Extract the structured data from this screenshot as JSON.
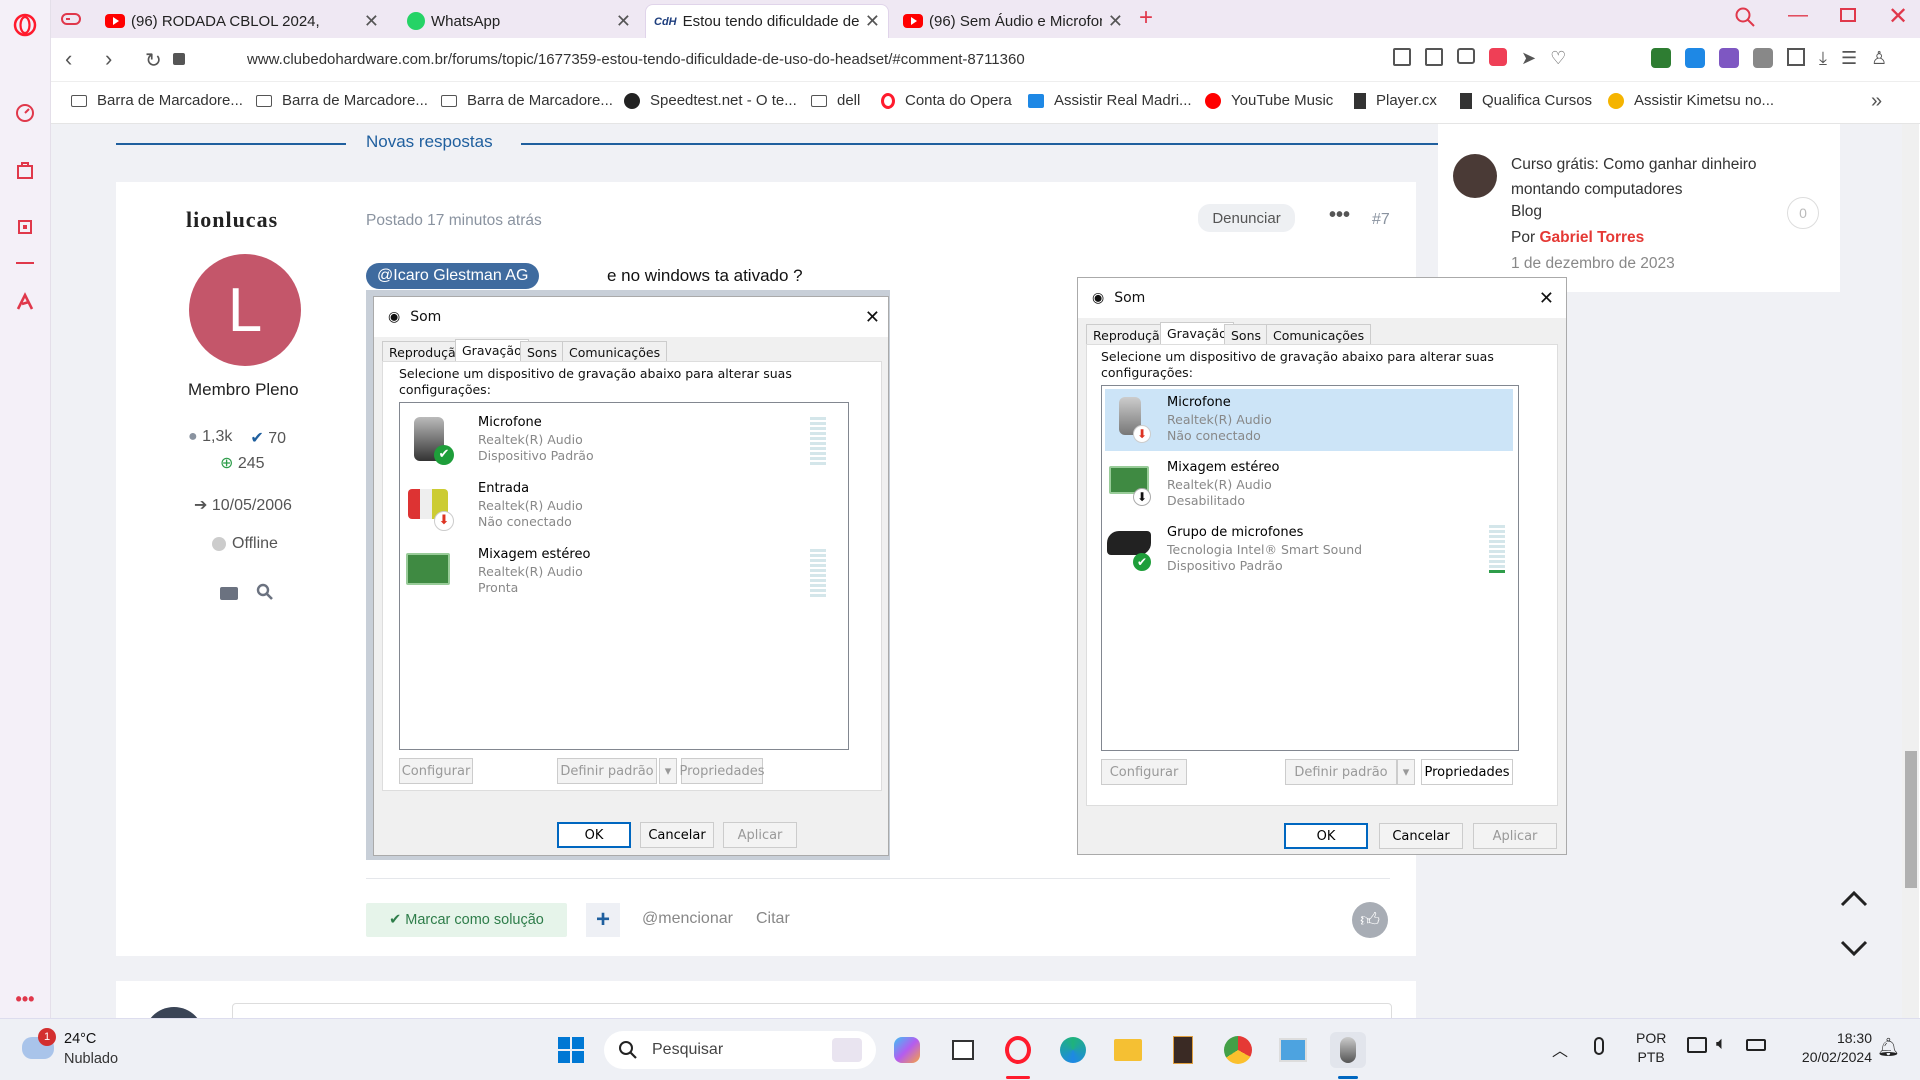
{
  "tabs": [
    {
      "title": "(96) RODADA CBLOL 2024,",
      "icon": "youtube-icon"
    },
    {
      "title": "WhatsApp",
      "icon": "whatsapp-icon"
    },
    {
      "title": "Estou tendo dificuldade de",
      "icon": "site-icon"
    },
    {
      "title": "(96) Sem Áudio e Microfon",
      "icon": "youtube-icon"
    }
  ],
  "address": {
    "url": "www.clubedohardware.com.br/forums/topic/1677359-estou-tendo-dificuldade-de-uso-do-headset/#comment-8711360"
  },
  "bookmarks": [
    "Barra de Marcadore...",
    "Barra de Marcadore...",
    "Barra de Marcadore...",
    "Speedtest.net - O te...",
    "dell",
    "Conta do Opera",
    "Assistir Real Madri...",
    "YouTube Music",
    "Player.cx",
    "Qualifica Cursos",
    "Assistir Kimetsu no..."
  ],
  "section": {
    "title": "Novas respostas"
  },
  "sidebar_post": {
    "title": "Curso grátis: Como ganhar dinheiro montando computadores",
    "category": "Blog",
    "by_prefix": "Por",
    "author": "Gabriel Torres",
    "date": "1 de dezembro de 2023",
    "comments": "0"
  },
  "post": {
    "author": "lionlucas",
    "avatar_letter": "L",
    "rank": "Membro Pleno",
    "posts": "1,3k",
    "solutions": "70",
    "reputation": "245",
    "joined": "10/05/2006",
    "status": "Offline",
    "posted": "Postado 17 minutos atrás",
    "report": "Denunciar",
    "number": "#7",
    "mention": "@Icaro Glestman AG",
    "text": "e no windows ta ativado ?",
    "mark_solution": "Marcar como solução",
    "plus": "+",
    "mention_btn": "@mencionar",
    "quote": "Citar"
  },
  "dialog1": {
    "title": "Som",
    "tabs": [
      "Reprodução",
      "Gravação",
      "Sons",
      "Comunicações"
    ],
    "instruction": "Selecione um dispositivo de gravação abaixo para alterar suas configurações:",
    "devices": [
      {
        "name": "Microfone",
        "driver": "Realtek(R) Audio",
        "state": "Dispositivo Padrão"
      },
      {
        "name": "Entrada",
        "driver": "Realtek(R) Audio",
        "state": "Não conectado"
      },
      {
        "name": "Mixagem estéreo",
        "driver": "Realtek(R) Audio",
        "state": "Pronta"
      }
    ],
    "configure": "Configurar",
    "set_default": "Definir padrão",
    "properties": "Propriedades",
    "ok": "OK",
    "cancel": "Cancelar",
    "apply": "Aplicar"
  },
  "dialog2": {
    "title": "Som",
    "tabs": [
      "Reprodução",
      "Gravação",
      "Sons",
      "Comunicações"
    ],
    "instruction": "Selecione um dispositivo de gravação abaixo para alterar suas configurações:",
    "devices": [
      {
        "name": "Microfone",
        "driver": "Realtek(R) Audio",
        "state": "Não conectado"
      },
      {
        "name": "Mixagem estéreo",
        "driver": "Realtek(R) Audio",
        "state": "Desabilitado"
      },
      {
        "name": "Grupo de microfones",
        "driver": "Tecnologia Intel® Smart Sound",
        "state": "Dispositivo Padrão"
      }
    ],
    "configure": "Configurar",
    "set_default": "Definir padrão",
    "properties": "Propriedades",
    "ok": "OK",
    "cancel": "Cancelar",
    "apply": "Aplicar"
  },
  "taskbar": {
    "weather_badge": "1",
    "temp": "24°C",
    "weather": "Nublado",
    "search": "Pesquisar",
    "lang1": "POR",
    "lang2": "PTB",
    "time": "18:30",
    "date": "20/02/2024"
  },
  "colors": {
    "accent": "#1f5f9e",
    "red": "#e53935",
    "avatar": "#c4566a",
    "opera": "#ff1b2d"
  }
}
